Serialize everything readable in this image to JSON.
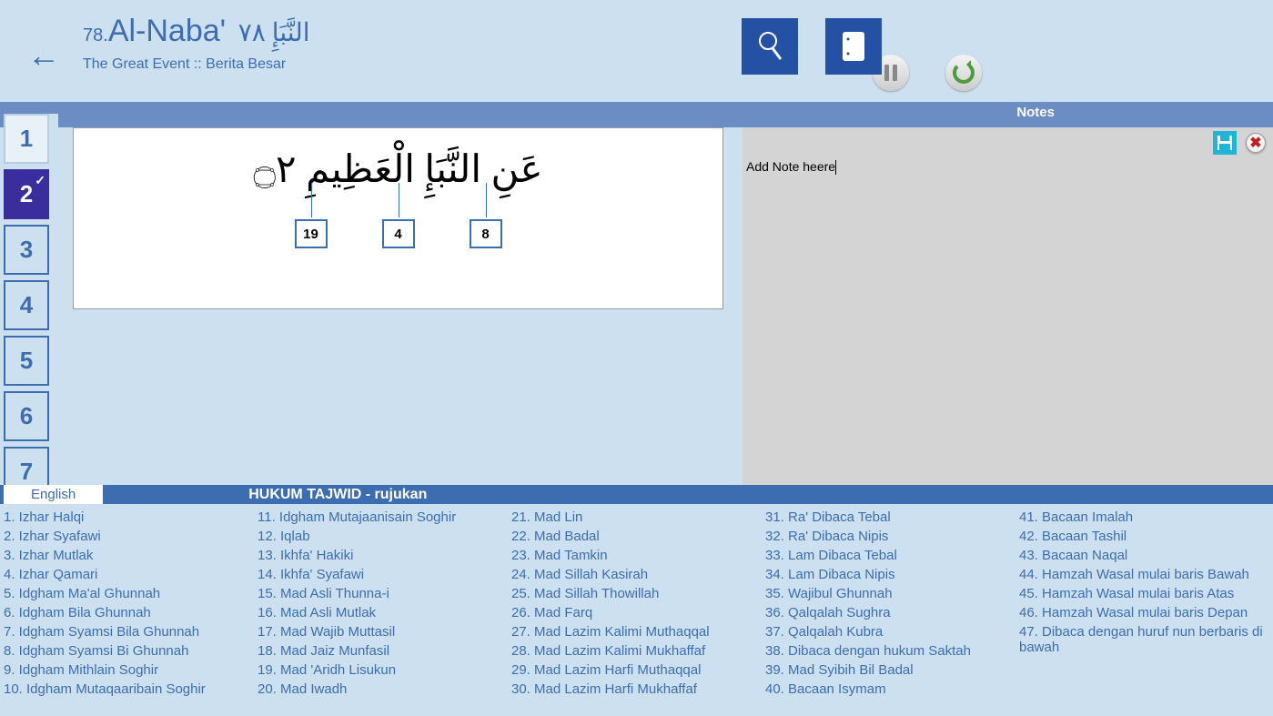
{
  "header": {
    "surah_number": "78.",
    "surah_name": "Al-Naba'",
    "arabic_name": "النَّبَإِ ٧٨",
    "subtitle": "The Great Event :: Berita Besar"
  },
  "verse_nav": [
    "1",
    "2",
    "3",
    "4",
    "5",
    "6",
    "7"
  ],
  "active_verse_index": 1,
  "verse": {
    "arabic": "عَنِ النَّبَإِ الْعَظِيمِ ۝٢",
    "markers": [
      "19",
      "4",
      "8"
    ]
  },
  "notes": {
    "panel_title": "Notes",
    "text": "Add Note heere"
  },
  "reference": {
    "language_tab": "English",
    "title": "HUKUM TAJWID - rujukan",
    "columns": [
      [
        "1. Izhar Halqi",
        "2. Izhar Syafawi",
        "3. Izhar Mutlak",
        "4. Izhar Qamari",
        "5. Idgham Ma'al Ghunnah",
        "6. Idgham Bila Ghunnah",
        "7. Idgham Syamsi Bila Ghunnah",
        "8. Idgham Syamsi Bi Ghunnah",
        "9. Idgham Mithlain Soghir",
        "10. Idgham Mutaqaaribain Soghir"
      ],
      [
        "11. Idgham Mutajaanisain Soghir",
        "12. Iqlab",
        "13. Ikhfa' Hakiki",
        "14. Ikhfa' Syafawi",
        "15. Mad Asli Thunna-i",
        "16. Mad Asli Mutlak",
        "17. Mad Wajib Muttasil",
        "18. Mad Jaiz Munfasil",
        "19. Mad 'Aridh Lisukun",
        "20. Mad Iwadh"
      ],
      [
        "21. Mad Lin",
        "22. Mad Badal",
        "23. Mad Tamkin",
        "24. Mad Sillah Kasirah",
        "25. Mad Sillah Thowillah",
        "26. Mad Farq",
        "27. Mad Lazim Kalimi Muthaqqal",
        "28. Mad Lazim Kalimi Mukhaffaf",
        "29. Mad Lazim Harfi Muthaqqal",
        "30. Mad Lazim Harfi Mukhaffaf"
      ],
      [
        "31. Ra' Dibaca Tebal",
        "32. Ra' Dibaca Nipis",
        "33. Lam Dibaca Tebal",
        "34. Lam Dibaca Nipis",
        "35. Wajibul Ghunnah",
        "36. Qalqalah Sughra",
        "37. Qalqalah Kubra",
        "38. Dibaca dengan hukum Saktah",
        "39. Mad Syibih Bil Badal",
        "40. Bacaan Isymam"
      ],
      [
        "41. Bacaan Imalah",
        "42. Bacaan Tashil",
        "43. Bacaan Naqal",
        "44. Hamzah Wasal mulai baris Bawah",
        "45. Hamzah Wasal mulai baris Atas",
        "46. Hamzah Wasal mulai baris Depan",
        "47. Dibaca dengan huruf nun berbaris di bawah"
      ]
    ]
  }
}
